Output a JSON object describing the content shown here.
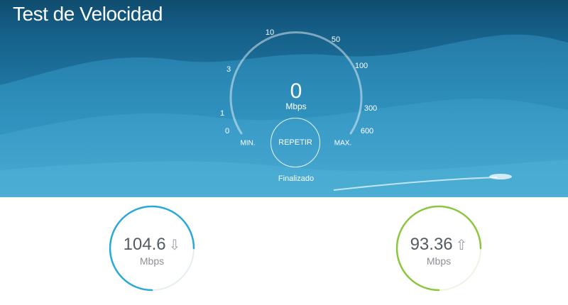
{
  "header": {
    "title": "Test de Velocidad"
  },
  "gauge": {
    "value": "0",
    "unit": "Mbps",
    "ticks": [
      "0",
      "1",
      "3",
      "10",
      "50",
      "100",
      "300",
      "600"
    ],
    "min_label": "MIN.",
    "max_label": "MAX.",
    "action_label": "REPETIR",
    "status": "Finalizado"
  },
  "results": {
    "download": {
      "value": "104.6",
      "arrow": "⇩",
      "unit": "Mbps",
      "color": "#2aa9d9"
    },
    "upload": {
      "value": "93.36",
      "arrow": "⇧",
      "unit": "Mbps",
      "color": "#8cc63f"
    }
  },
  "colors": {
    "banner": "#1f76a2",
    "page": "#ffffff"
  }
}
